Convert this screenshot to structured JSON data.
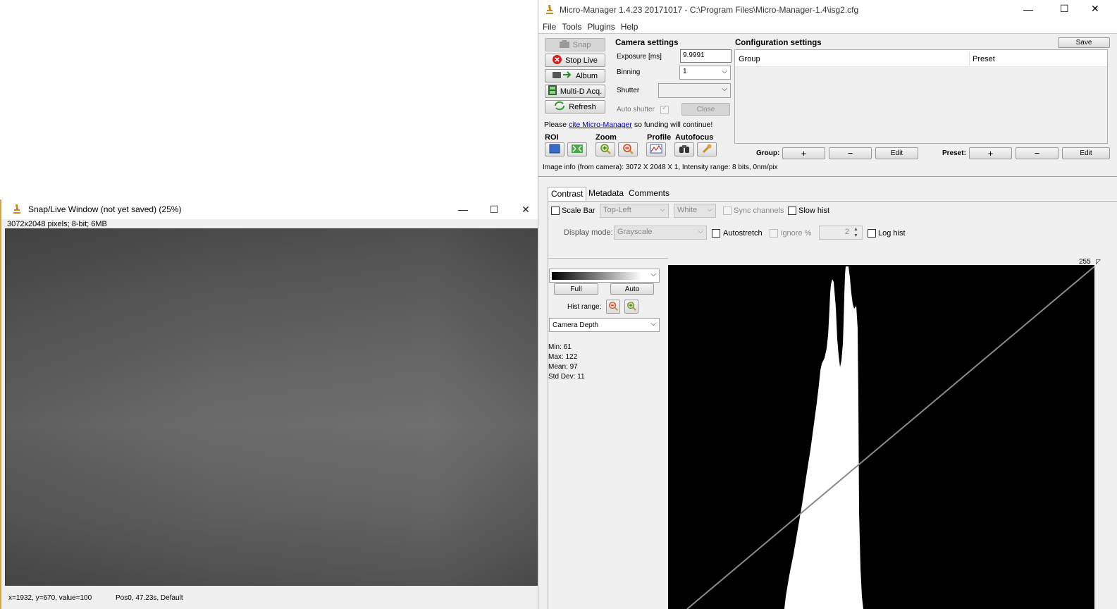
{
  "snap_window": {
    "title": "Snap/Live Window (not yet saved) (25%)",
    "info": "3072x2048 pixels; 8-bit; 6MB",
    "status_coords": "x=1932, y=670, value=100",
    "status_pos": "Pos0, 47.23s, Default"
  },
  "main_window": {
    "title": "Micro-Manager 1.4.23 20171017 - C:\\Program Files\\Micro-Manager-1.4\\isg2.cfg",
    "menu": [
      "File",
      "Tools",
      "Plugins",
      "Help"
    ]
  },
  "left_buttons": {
    "snap": "Snap",
    "stop_live": "Stop Live",
    "album": "Album",
    "multi_d": "Multi-D Acq.",
    "refresh": "Refresh"
  },
  "camera": {
    "heading": "Camera settings",
    "exposure_label": "Exposure [ms]",
    "exposure_value": "9.9991",
    "binning_label": "Binning",
    "binning_value": "1",
    "shutter_label": "Shutter",
    "shutter_value": "",
    "auto_shutter_label": "Auto shutter",
    "close_label": "Close"
  },
  "cite": {
    "prefix": "Please",
    "link": "cite Micro-Manager",
    "suffix": "so funding will continue!"
  },
  "toolbar_labels": {
    "roi": "ROI",
    "zoom": "Zoom",
    "profile": "Profile",
    "autofocus": "Autofocus"
  },
  "config": {
    "heading": "Configuration settings",
    "save_label": "Save",
    "col_group": "Group",
    "col_preset": "Preset",
    "group_label": "Group:",
    "preset_label": "Preset:",
    "plus": "+",
    "minus": "−",
    "edit": "Edit"
  },
  "image_info": "Image info (from camera): 3072 X 2048 X 1, Intensity range: 8 bits, 0nm/pix",
  "tabs": [
    "Contrast",
    "Metadata",
    "Comments"
  ],
  "contrast": {
    "scale_bar_label": "Scale Bar",
    "position_value": "Top-Left",
    "color_value": "White",
    "sync_channels_label": "Sync channels",
    "slow_hist_label": "Slow hist",
    "display_mode_label": "Display mode:",
    "display_mode_value": "Grayscale",
    "autostretch_label": "Autostretch",
    "ignore_label": "ignore %",
    "ignore_value": "2",
    "log_hist_label": "Log hist",
    "full_label": "Full",
    "auto_label": "Auto",
    "hist_range_label": "Hist range:",
    "depth_value": "Camera Depth",
    "stats": {
      "min": "Min: 61",
      "max": "Max: 122",
      "mean": "Mean: 97",
      "std": "Std Dev: 11"
    },
    "hist_max_label": "255"
  },
  "colors": {
    "accent_red": "#d42020",
    "link_blue": "#0000cc",
    "histogram_bg": "#000000",
    "histogram_fg": "#ffffff"
  }
}
